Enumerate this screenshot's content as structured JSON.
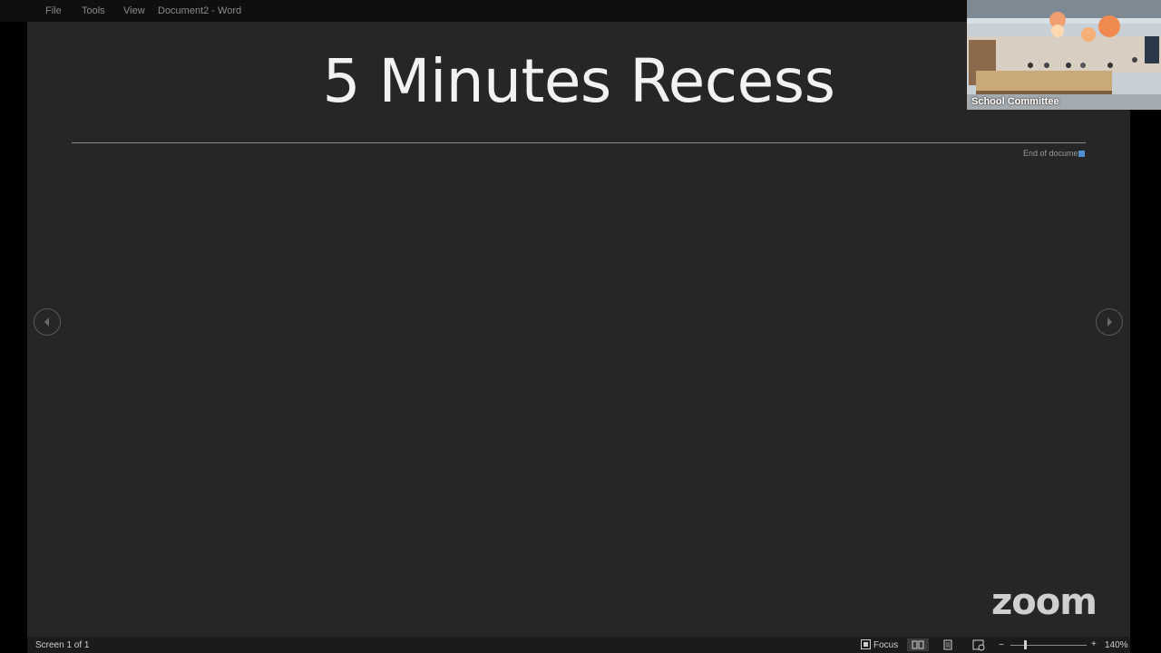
{
  "menubar": {
    "items": [
      "File",
      "Tools",
      "View"
    ],
    "doc_title": "Document2  -  Word"
  },
  "document": {
    "heading": "5 Minutes Recess",
    "end_label": "End of document"
  },
  "video": {
    "participant_label": "School Committee"
  },
  "watermark": "zoom",
  "statusbar": {
    "page_info": "Screen 1 of 1",
    "focus_label": "Focus",
    "zoom_minus": "−",
    "zoom_plus": "+",
    "zoom_level": "140%"
  },
  "colors": {
    "background": "#262626",
    "end_marker": "#4f8fd1",
    "heading": "#f2f2f2"
  }
}
